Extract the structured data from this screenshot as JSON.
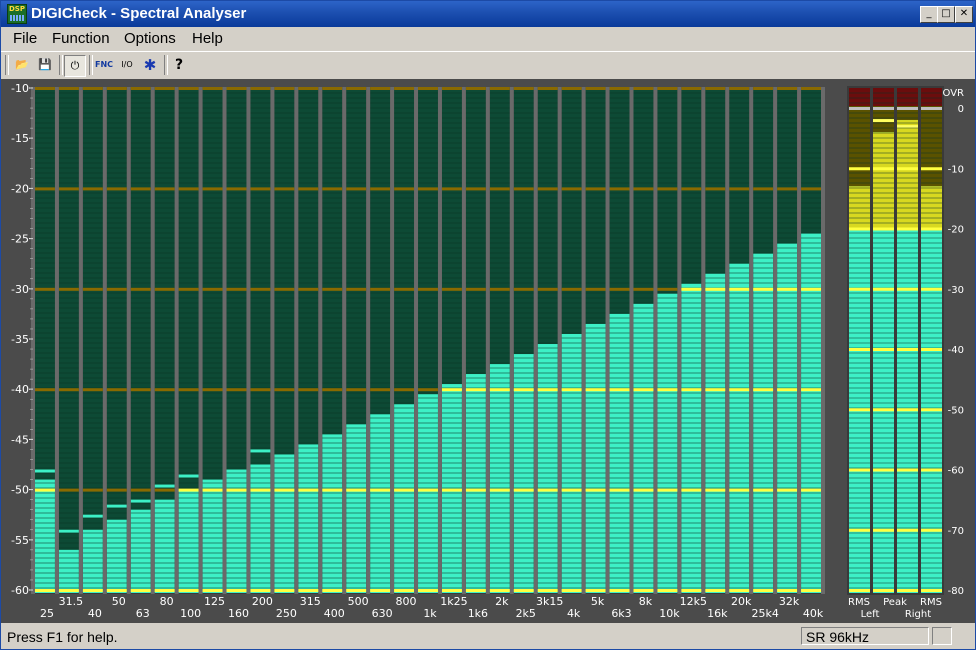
{
  "window": {
    "title": "DIGICheck - Spectral Analyser",
    "icon_label": "DSP"
  },
  "title_buttons": [
    {
      "name": "minimize-button",
      "glyph": "_"
    },
    {
      "name": "maximize-button",
      "glyph": "□"
    },
    {
      "name": "close-button",
      "glyph": "✕"
    }
  ],
  "menu": [
    "File",
    "Function",
    "Options",
    "Help"
  ],
  "toolbar": [
    {
      "name": "open-icon",
      "glyph": "📂"
    },
    {
      "name": "save-icon",
      "glyph": "💾"
    },
    {
      "name": "power-icon",
      "glyph": "⏻"
    },
    {
      "name": "fnc-icon",
      "glyph": "FNC"
    },
    {
      "name": "io-icon",
      "glyph": "I/O"
    },
    {
      "name": "bug-icon",
      "glyph": "✱"
    },
    {
      "name": "help-icon",
      "glyph": "?"
    }
  ],
  "spectrum": {
    "y_ticks": [
      "-10",
      "-15",
      "-20",
      "-25",
      "-30",
      "-35",
      "-40",
      "-45",
      "-50",
      "-55",
      "-60"
    ],
    "bands_upper": [
      "31.5",
      "50",
      "80",
      "125",
      "200",
      "315",
      "500",
      "800",
      "1k25",
      "2k",
      "3k15",
      "5k",
      "8k",
      "12k5",
      "20k",
      "32k"
    ],
    "bands_lower": [
      "25",
      "40",
      "63",
      "100",
      "160",
      "250",
      "400",
      "630",
      "1k",
      "1k6",
      "2k5",
      "4k",
      "6k3",
      "10k",
      "16k",
      "25k4",
      "40k"
    ],
    "levels_db": [
      -49,
      -56,
      -54,
      -53,
      -52,
      -51,
      -50,
      -49,
      -48,
      -47.5,
      -46.5,
      -45.5,
      -44.5,
      -43.5,
      -42.5,
      -41.5,
      -40.5,
      -39.5,
      -38.5,
      -37.5,
      -36.5,
      -35.5,
      -34.5,
      -33.5,
      -32.5,
      -31.5,
      -30.5,
      -29.5,
      -28.5,
      -27.5,
      -26.5,
      -25.5,
      -24.5
    ],
    "peaks_db": [
      -48,
      -54,
      -52.5,
      -51.5,
      -51,
      -49.5,
      -48.5,
      null,
      null,
      -46,
      null,
      null,
      null,
      null,
      null,
      null,
      null,
      -39.5,
      -38.5,
      null,
      null,
      null,
      null,
      null,
      null,
      null,
      -30.5,
      null,
      null,
      null,
      null,
      null,
      null
    ],
    "colors": {
      "bar": "#3df0c6",
      "background": "#0d4a35",
      "grid_major": "#8a6a00",
      "highlight": "#ffff40"
    }
  },
  "meters": {
    "scale": [
      "OVR",
      "0",
      "-10",
      "-20",
      "-30",
      "-40",
      "-50",
      "-60",
      "-70",
      "-80"
    ],
    "labels_top": [
      "RMS",
      "Peak",
      "RMS"
    ],
    "labels_bottom": [
      "Left",
      "Right"
    ],
    "levels_db": [
      -13,
      -4,
      -2,
      -13
    ],
    "peaks_db": [
      null,
      -2,
      -3,
      null
    ]
  },
  "status": {
    "text": "Press F1 for help.",
    "sample_rate": "SR 96kHz"
  }
}
